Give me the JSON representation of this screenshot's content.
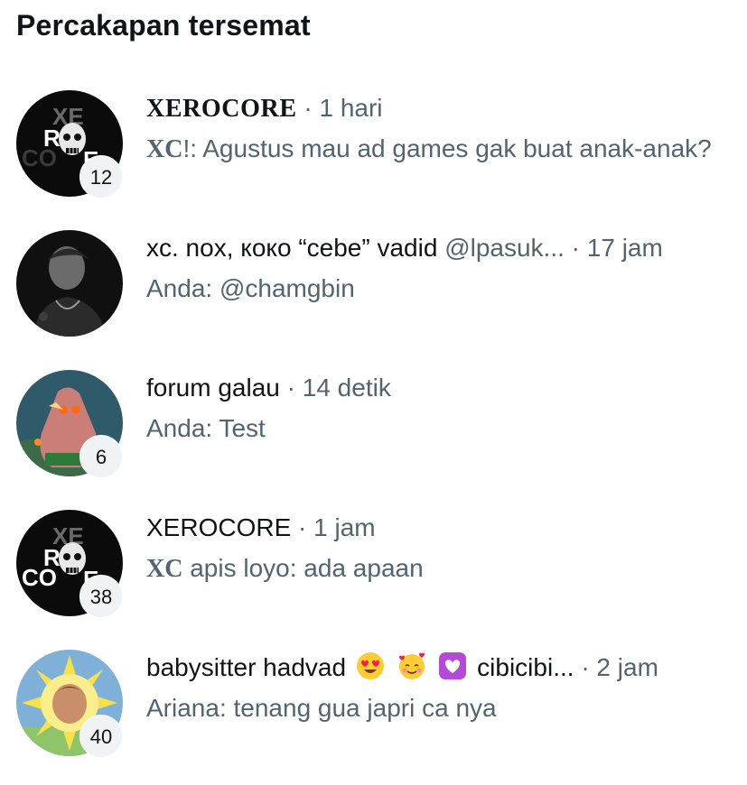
{
  "header": {
    "title": "Percakapan tersemat"
  },
  "conversations": [
    {
      "name": "XEROCORE",
      "time": "· 1 hari",
      "preview_prefix": "XC",
      "preview_text": "!: Agustus mau ad games gak buat anak-anak?",
      "badge": "12",
      "avatar": "skull-logo"
    },
    {
      "name": "xc. nox, коко “cebe” vadid",
      "handle": "@lpasuk...",
      "time": "· 17 jam",
      "preview_text": "Anda: @chamgbin",
      "avatar": "person-photo"
    },
    {
      "name": "forum galau",
      "time": "· 14 detik",
      "preview_text": "Anda: Test",
      "badge": "6",
      "avatar": "starfish-glowing-eyes"
    },
    {
      "name": "XEROCORE",
      "time": "· 1 jam",
      "preview_prefix": "XC",
      "preview_text": " apis loyo: ada apaan",
      "badge": "38",
      "avatar": "skull-logo"
    },
    {
      "name": "babysitter hadvad",
      "name_suffix": "cibicibi...",
      "time": "· 2 jam",
      "preview_text": "Ariana: tenang gua japri ca nya",
      "badge": "40",
      "avatar": "face-in-sun",
      "emojis": [
        "heart-eyes-emoji",
        "smiling-hearts-emoji",
        "heart-box-emoji"
      ]
    }
  ],
  "colors": {
    "text_primary": "#0f1419",
    "text_secondary": "#536471",
    "badge_bg": "#eff3f4"
  }
}
